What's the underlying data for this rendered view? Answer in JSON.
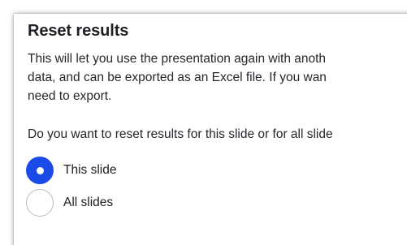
{
  "dialog": {
    "title": "Reset results",
    "description_lines": [
      "This will let you use the presentation again with anoth",
      "data, and can be exported as an Excel file. If you wan",
      "need to export."
    ],
    "question": "Do you want to reset results for this slide or for all slide",
    "options": [
      {
        "label": "This slide",
        "selected": true
      },
      {
        "label": "All slides",
        "selected": false
      }
    ]
  },
  "colors": {
    "accent": "#1a4be8",
    "radio_border": "#b9b9c2"
  }
}
